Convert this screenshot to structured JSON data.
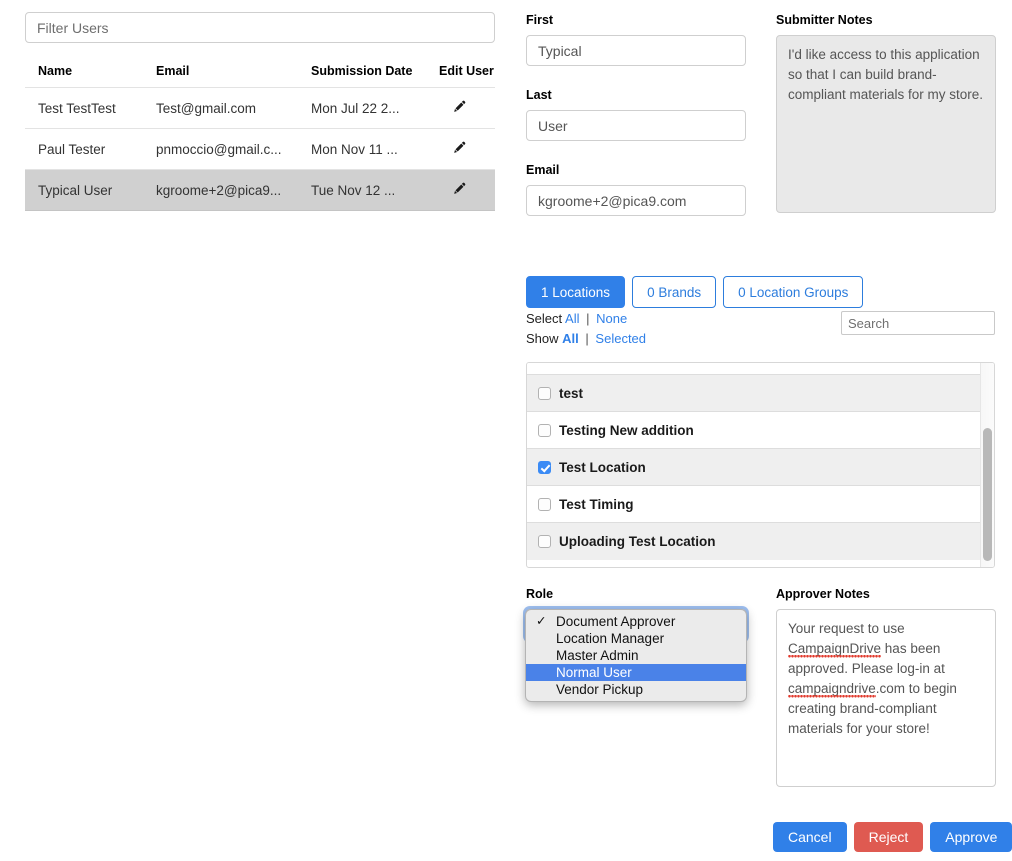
{
  "left": {
    "filter_placeholder": "Filter Users",
    "filter_value": "",
    "table": {
      "columns": [
        "Name",
        "Email",
        "Submission Date",
        "Edit User"
      ],
      "rows": [
        {
          "name": "Test TestTest",
          "email": "Test@gmail.com",
          "date": "Mon Jul 22 2...",
          "edit_icon": "pencil-icon",
          "selected": false
        },
        {
          "name": "Paul Tester",
          "email": "pnmoccio@gmail.c...",
          "date": "Mon Nov 11 ...",
          "edit_icon": "pencil-icon",
          "selected": false
        },
        {
          "name": "Typical User",
          "email": "kgroome+2@pica9...",
          "date": "Tue Nov 12 ...",
          "edit_icon": "pencil-icon",
          "selected": true
        }
      ]
    }
  },
  "form": {
    "first_label": "First",
    "first_value": "Typical",
    "last_label": "Last",
    "last_value": "User",
    "email_label": "Email",
    "email_value": "kgroome+2@pica9.com"
  },
  "submitter_notes": {
    "label": "Submitter Notes",
    "value": "I'd like access to this application so that I can build brand-compliant materials for my store."
  },
  "assignment": {
    "tabs": [
      {
        "label": "1 Locations",
        "active": true
      },
      {
        "label": "0 Brands",
        "active": false
      },
      {
        "label": "0 Location Groups",
        "active": false
      }
    ],
    "select_label": "Select",
    "select_all": "All",
    "select_none": "None",
    "show_label": "Show",
    "show_all": "All",
    "show_selected": "Selected",
    "separator": "|",
    "search_placeholder": "Search",
    "search_value": "",
    "locations": [
      {
        "label": "test",
        "checked": false
      },
      {
        "label": "Testing New addition",
        "checked": false
      },
      {
        "label": "Test Location",
        "checked": true
      },
      {
        "label": "Test Timing",
        "checked": false
      },
      {
        "label": "Uploading Test Location",
        "checked": false
      }
    ]
  },
  "role": {
    "label": "Role",
    "selected": "Document Approver",
    "highlighted": "Normal User",
    "options": [
      {
        "label": "Document Approver",
        "checked": true,
        "highlighted": false
      },
      {
        "label": "Location Manager",
        "checked": false,
        "highlighted": false
      },
      {
        "label": "Master Admin",
        "checked": false,
        "highlighted": false
      },
      {
        "label": "Normal User",
        "checked": false,
        "highlighted": true
      },
      {
        "label": "Vendor Pickup",
        "checked": false,
        "highlighted": false
      }
    ]
  },
  "approver_notes": {
    "label": "Approver Notes",
    "part1": "Your request to use ",
    "misspelled1": "CampaignDrive",
    "part2": " has been approved. Please log-in at ",
    "misspelled2": "campaigndrive",
    "part3": ".com to begin creating brand-compliant materials for your store!"
  },
  "actions": {
    "cancel": "Cancel",
    "reject": "Reject",
    "approve": "Approve"
  },
  "colors": {
    "primary_blue": "#3080e8",
    "danger_red": "#df5a51",
    "link_blue": "#3080e8",
    "row_selected": "#d0d0d0",
    "highlight_blue": "#4a82e8"
  }
}
